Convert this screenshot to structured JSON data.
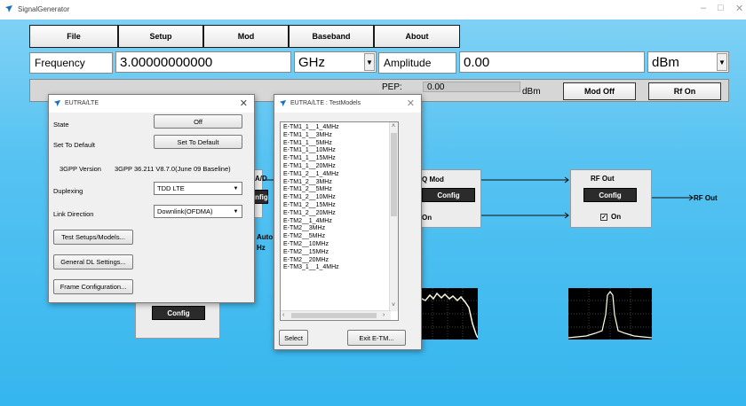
{
  "window": {
    "title": "SignalGenerator",
    "controls": {
      "minimize": "–",
      "maximize": "□",
      "close": "✕"
    }
  },
  "menu": [
    "File",
    "Setup",
    "Mod",
    "Baseband",
    "About"
  ],
  "frequency": {
    "label": "Frequency",
    "value": "3.00000000000",
    "unit": "GHz"
  },
  "amplitude": {
    "label": "Amplitude",
    "value": "0.00",
    "unit": "dBm"
  },
  "status": {
    "pep_label": "PEP:",
    "pep_value": "0.00",
    "pep_unit": "dBm",
    "mod_button": "Mod Off",
    "rf_button": "Rf On"
  },
  "blocks": {
    "dac_title_fragment": "A/D",
    "dac_config_fragment": "onfig",
    "auto_fragment": "Auto",
    "hz_fragment": "Hz",
    "baseband_config": "Config",
    "iq": {
      "title": "Q Mod",
      "config": "Config",
      "check": "On"
    },
    "rf": {
      "title": "RF Out",
      "config": "Config",
      "check": "On",
      "checked_mark": "☑",
      "output_label": "RF Out"
    }
  },
  "lte_dialog": {
    "title": "EUTRA/LTE",
    "state_label": "State",
    "state_button": "Off",
    "default_label": "Set To Default",
    "default_button": "Set To Default",
    "version_label": "3GPP Version",
    "version_value": "3GPP 36.211 V8.7.0(June 09 Baseline)",
    "duplexing_label": "Duplexing",
    "duplexing_value": "TDD LTE",
    "direction_label": "Link Direction",
    "direction_value": "Downlink(OFDMA)",
    "btn_test_setups": "Test Setups/Models...",
    "btn_general_dl": "General DL Settings...",
    "btn_frame_config": "Frame Configuration..."
  },
  "testmodels_dialog": {
    "title": "EUTRA/LTE : TestModels",
    "items": [
      "E-TM1_1__1_4MHz",
      "E-TM1_1__3MHz",
      "E-TM1_1__5MHz",
      "E-TM1_1__10MHz",
      "E-TM1_1__15MHz",
      "E-TM1_1__20MHz",
      "E-TM1_2__1_4MHz",
      "E-TM1_2__3MHz",
      "E-TM1_2__5MHz",
      "E-TM1_2__10MHz",
      "E-TM1_2__15MHz",
      "E-TM1_2__20MHz",
      "E-TM2__1_4MHz",
      "E-TM2__3MHz",
      "E-TM2__5MHz",
      "E-TM2__10MHz",
      "E-TM2__15MHz",
      "E-TM2__20MHz",
      "E-TM3_1__1_4MHz"
    ],
    "select_button": "Select",
    "exit_button": "Exit E-TM..."
  },
  "icons": {
    "app": "app-logo-icon",
    "close": "close-icon",
    "arrow": "arrow-right-icon",
    "dropdown": "chevron-down-icon"
  }
}
